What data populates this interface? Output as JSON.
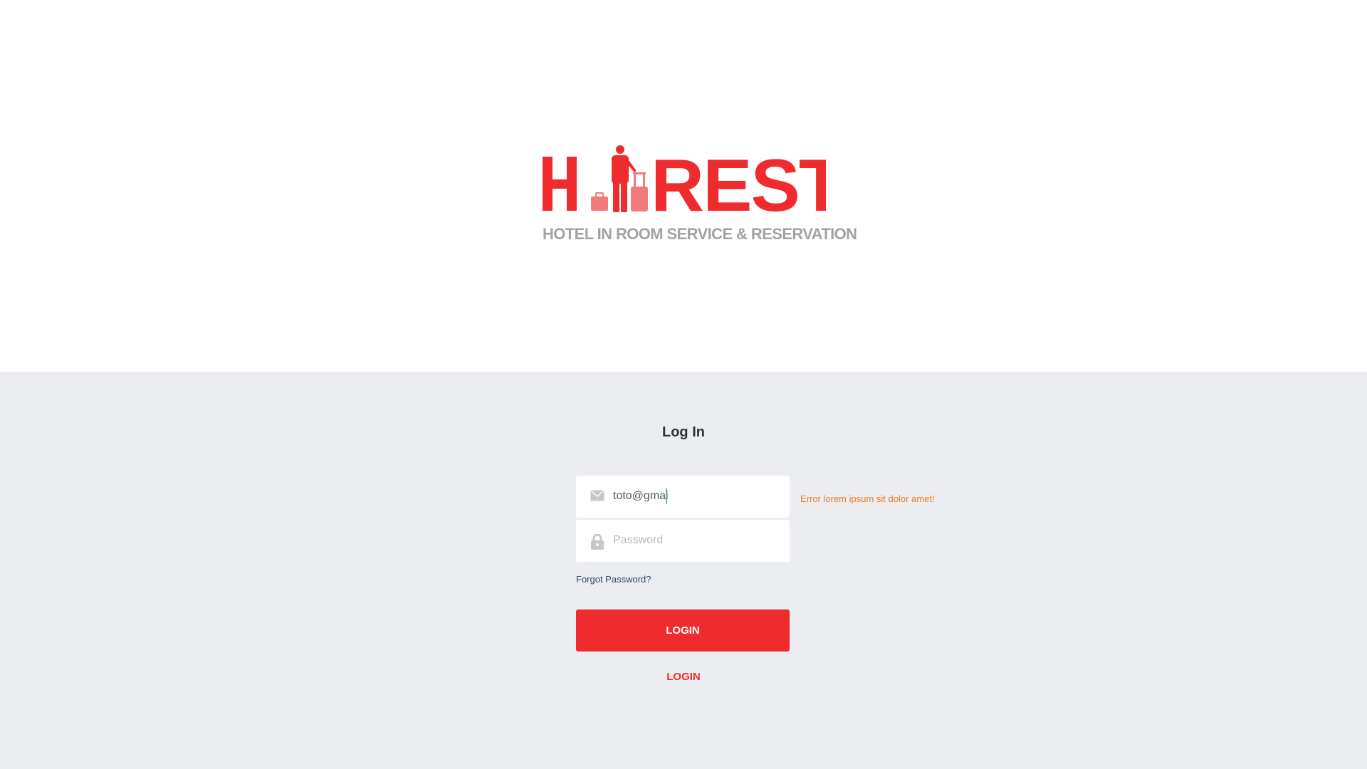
{
  "brand": {
    "logo_text": "HIREST",
    "subtitle": "HOTEL IN ROOM SERVICE & RESERVATION",
    "primary_color": "#ef2b2d",
    "luggage_color": "#f07b7b",
    "subtitle_color": "#a3a3a3"
  },
  "form": {
    "title": "Log In",
    "email": {
      "value": "toto@gmai",
      "placeholder": "",
      "icon": "envelope-icon"
    },
    "password": {
      "value": "",
      "placeholder": "Password",
      "icon": "lock-icon"
    },
    "error_message": "Error lorem ipsum sit dolor amet!",
    "forgot_password": "Forgot Password?",
    "login_button": "LOGIN",
    "login_link": "LOGIN"
  },
  "colors": {
    "background_bottom": "#ebedf1",
    "error": "#f07c22",
    "link": "#33496b"
  }
}
